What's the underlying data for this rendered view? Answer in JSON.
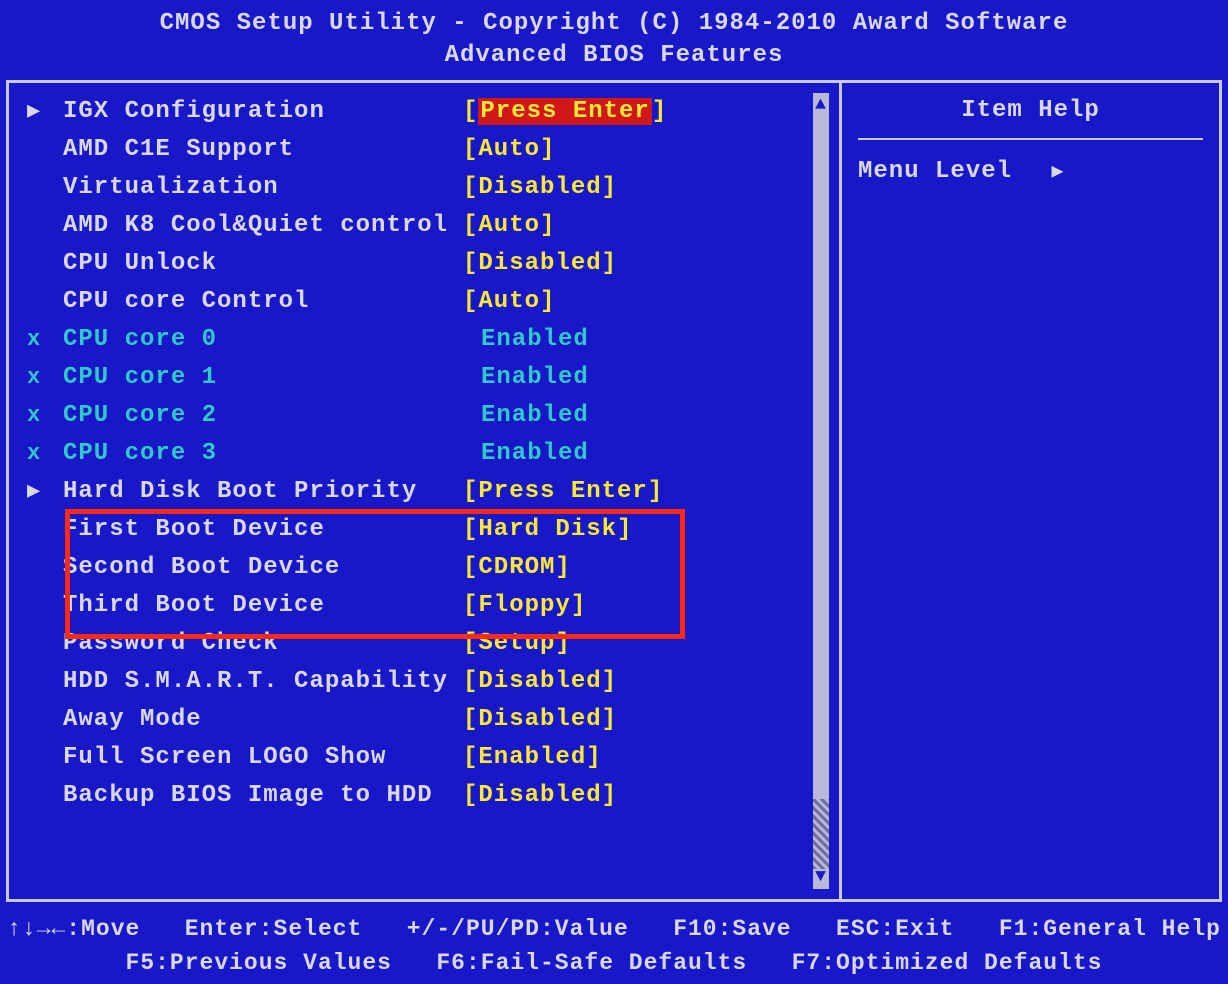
{
  "header": {
    "title_line1": "CMOS Setup Utility - Copyright (C) 1984-2010 Award Software",
    "title_line2": "Advanced BIOS Features"
  },
  "settings": [
    {
      "marker": "▶",
      "label": "IGX Configuration",
      "value": "Press Enter",
      "bracketed": true,
      "highlight": true,
      "dim": false
    },
    {
      "marker": "",
      "label": "AMD C1E Support",
      "value": "Auto",
      "bracketed": true,
      "highlight": false,
      "dim": false
    },
    {
      "marker": "",
      "label": "Virtualization",
      "value": "Disabled",
      "bracketed": true,
      "highlight": false,
      "dim": false
    },
    {
      "marker": "",
      "label": "AMD K8 Cool&Quiet control",
      "value": "Auto",
      "bracketed": true,
      "highlight": false,
      "dim": false
    },
    {
      "marker": "",
      "label": "CPU Unlock",
      "value": "Disabled",
      "bracketed": true,
      "highlight": false,
      "dim": false
    },
    {
      "marker": "",
      "label": "CPU core Control",
      "value": "Auto",
      "bracketed": true,
      "highlight": false,
      "dim": false
    },
    {
      "marker": "x",
      "label": "CPU core 0",
      "value": "Enabled",
      "bracketed": false,
      "highlight": false,
      "dim": true
    },
    {
      "marker": "x",
      "label": "CPU core 1",
      "value": "Enabled",
      "bracketed": false,
      "highlight": false,
      "dim": true
    },
    {
      "marker": "x",
      "label": "CPU core 2",
      "value": "Enabled",
      "bracketed": false,
      "highlight": false,
      "dim": true
    },
    {
      "marker": "x",
      "label": "CPU core 3",
      "value": "Enabled",
      "bracketed": false,
      "highlight": false,
      "dim": true
    },
    {
      "marker": "▶",
      "label": "Hard Disk Boot Priority",
      "value": "Press Enter",
      "bracketed": true,
      "highlight": false,
      "dim": false
    },
    {
      "marker": "",
      "label": "First Boot Device",
      "value": "Hard Disk",
      "bracketed": true,
      "highlight": false,
      "dim": false
    },
    {
      "marker": "",
      "label": "Second Boot Device",
      "value": "CDROM",
      "bracketed": true,
      "highlight": false,
      "dim": false
    },
    {
      "marker": "",
      "label": "Third Boot Device",
      "value": "Floppy",
      "bracketed": true,
      "highlight": false,
      "dim": false
    },
    {
      "marker": "",
      "label": "Password Check",
      "value": "Setup",
      "bracketed": true,
      "highlight": false,
      "dim": false
    },
    {
      "marker": "",
      "label": "HDD S.M.A.R.T. Capability",
      "value": "Disabled",
      "bracketed": true,
      "highlight": false,
      "dim": false
    },
    {
      "marker": "",
      "label": "Away Mode",
      "value": "Disabled",
      "bracketed": true,
      "highlight": false,
      "dim": false
    },
    {
      "marker": "",
      "label": "Full Screen LOGO Show",
      "value": "Enabled",
      "bracketed": true,
      "highlight": false,
      "dim": false
    },
    {
      "marker": "",
      "label": "Backup BIOS Image to HDD",
      "value": "Disabled",
      "bracketed": true,
      "highlight": false,
      "dim": false
    }
  ],
  "help": {
    "title": "Item Help",
    "menu_level_label": "Menu Level"
  },
  "footer": {
    "line1": "↑↓→←:Move   Enter:Select   +/-/PU/PD:Value   F10:Save   ESC:Exit   F1:General Help",
    "line2": "F5:Previous Values   F6:Fail-Safe Defaults   F7:Optimized Defaults"
  }
}
